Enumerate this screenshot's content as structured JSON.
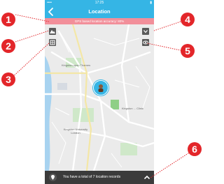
{
  "status_bar": {
    "carrier": "•••• ",
    "time": "17:25",
    "battery": "▮"
  },
  "nav": {
    "back_icon": "chevron-left-icon",
    "title": "Location"
  },
  "gps_banner": {
    "text": "GPS based location accuracy: 80%"
  },
  "map": {
    "controls": [
      {
        "name": "map-type-icon",
        "glyph": "▲"
      },
      {
        "name": "satellite-view-icon",
        "glyph": "▦"
      },
      {
        "name": "dropdown-icon",
        "glyph": "▾"
      },
      {
        "name": "eye-icon",
        "glyph": "●"
      }
    ],
    "labels": {
      "kingston_upon_thames": "Kingston upon Thames",
      "kingston_university": "Kingston University London",
      "kingston_right": "Kingston ... Clinic"
    },
    "pin_icon": "user-avatar-icon"
  },
  "bottom_bar": {
    "records_text": "You have a total of 7 location records",
    "location_icon": "location-records-icon",
    "expand_icon": "chevron-up-icon"
  },
  "callouts": [
    "1",
    "2",
    "3",
    "4",
    "5",
    "6"
  ],
  "colors": {
    "accent": "#35b5e5",
    "banner": "#f28f9a",
    "callout": "#e3262a",
    "bottom_bar": "#3b3b3b"
  }
}
